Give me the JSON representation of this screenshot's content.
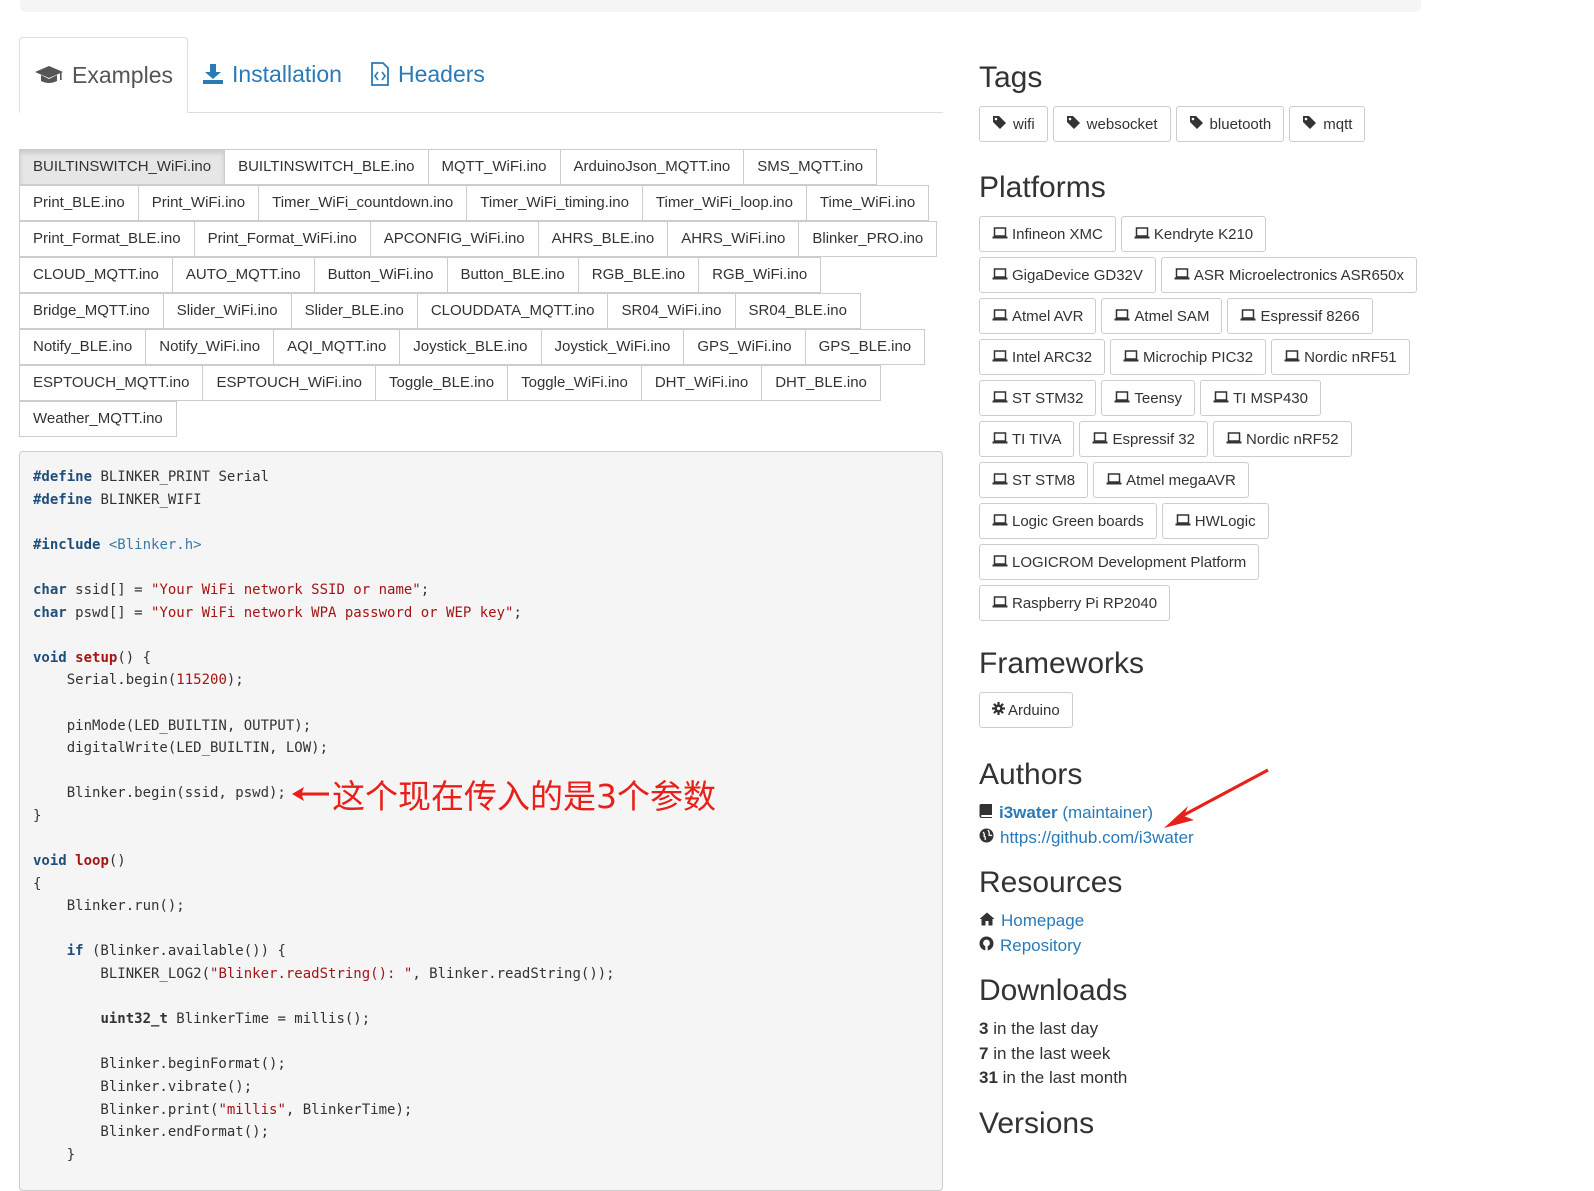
{
  "tabs": [
    {
      "label": "Examples",
      "icon": "graduation-cap-icon",
      "active": true
    },
    {
      "label": "Installation",
      "icon": "download-icon",
      "active": false
    },
    {
      "label": "Headers",
      "icon": "code-file-icon",
      "active": false
    }
  ],
  "file_rows": [
    [
      "BUILTINSWITCH_WiFi.ino",
      "BUILTINSWITCH_BLE.ino",
      "MQTT_WiFi.ino",
      "ArduinoJson_MQTT.ino",
      "SMS_MQTT.ino"
    ],
    [
      "Print_BLE.ino",
      "Print_WiFi.ino",
      "Timer_WiFi_countdown.ino",
      "Timer_WiFi_timing.ino",
      "Timer_WiFi_loop.ino",
      "Time_WiFi.ino"
    ],
    [
      "Print_Format_BLE.ino",
      "Print_Format_WiFi.ino",
      "APCONFIG_WiFi.ino",
      "AHRS_BLE.ino",
      "AHRS_WiFi.ino",
      "Blinker_PRO.ino"
    ],
    [
      "CLOUD_MQTT.ino",
      "AUTO_MQTT.ino",
      "Button_WiFi.ino",
      "Button_BLE.ino",
      "RGB_BLE.ino",
      "RGB_WiFi.ino"
    ],
    [
      "Bridge_MQTT.ino",
      "Slider_WiFi.ino",
      "Slider_BLE.ino",
      "CLOUDDATA_MQTT.ino",
      "SR04_WiFi.ino",
      "SR04_BLE.ino"
    ],
    [
      "Notify_BLE.ino",
      "Notify_WiFi.ino",
      "AQI_MQTT.ino",
      "Joystick_BLE.ino",
      "Joystick_WiFi.ino",
      "GPS_WiFi.ino",
      "GPS_BLE.ino"
    ],
    [
      "ESPTOUCH_MQTT.ino",
      "ESPTOUCH_WiFi.ino",
      "Toggle_BLE.ino",
      "Toggle_WiFi.ino",
      "DHT_WiFi.ino",
      "DHT_BLE.ino"
    ],
    [
      "Weather_MQTT.ino"
    ]
  ],
  "active_file": "BUILTINSWITCH_WiFi.ino",
  "code_lines": [
    [
      [
        "pp",
        "#define"
      ],
      [
        "t",
        " BLINKER_PRINT Serial"
      ]
    ],
    [
      [
        "pp",
        "#define"
      ],
      [
        "t",
        " BLINKER_WIFI"
      ]
    ],
    [],
    [
      [
        "pp",
        "#include"
      ],
      [
        "t",
        " "
      ],
      [
        "inc",
        "<Blinker.h>"
      ]
    ],
    [],
    [
      [
        "kw",
        "char"
      ],
      [
        "t",
        " ssid[] = "
      ],
      [
        "str",
        "\"Your WiFi network SSID or name\""
      ],
      [
        "t",
        ";"
      ]
    ],
    [
      [
        "kw",
        "char"
      ],
      [
        "t",
        " pswd[] = "
      ],
      [
        "str",
        "\"Your WiFi network WPA password or WEP key\""
      ],
      [
        "t",
        ";"
      ]
    ],
    [],
    [
      [
        "kw",
        "void"
      ],
      [
        "t",
        " "
      ],
      [
        "fn",
        "setup"
      ],
      [
        "t",
        "() {"
      ]
    ],
    [
      [
        "t",
        "    Serial.begin("
      ],
      [
        "num",
        "115200"
      ],
      [
        "t",
        ");"
      ]
    ],
    [],
    [
      [
        "t",
        "    pinMode(LED_BUILTIN, OUTPUT);"
      ]
    ],
    [
      [
        "t",
        "    digitalWrite(LED_BUILTIN, LOW);"
      ]
    ],
    [],
    [
      [
        "t",
        "    Blinker.begin(ssid, pswd);"
      ]
    ],
    [
      [
        "t",
        "}"
      ]
    ],
    [],
    [
      [
        "kw",
        "void"
      ],
      [
        "t",
        " "
      ],
      [
        "fn",
        "loop"
      ],
      [
        "t",
        "()"
      ]
    ],
    [
      [
        "t",
        "{"
      ]
    ],
    [
      [
        "t",
        "    Blinker.run();"
      ]
    ],
    [],
    [
      [
        "t",
        "    "
      ],
      [
        "kw",
        "if"
      ],
      [
        "t",
        " (Blinker.available()) {"
      ]
    ],
    [
      [
        "t",
        "        BLINKER_LOG2("
      ],
      [
        "str",
        "\"Blinker.readString(): \""
      ],
      [
        "t",
        ", Blinker.readString());"
      ]
    ],
    [],
    [
      [
        "t",
        "        "
      ],
      [
        "type",
        "uint32_t"
      ],
      [
        "t",
        " BlinkerTime = millis();"
      ]
    ],
    [],
    [
      [
        "t",
        "        Blinker.beginFormat();"
      ]
    ],
    [
      [
        "t",
        "        Blinker.vibrate();"
      ]
    ],
    [
      [
        "t",
        "        Blinker.print("
      ],
      [
        "str",
        "\"millis\""
      ],
      [
        "t",
        ", BlinkerTime);"
      ]
    ],
    [
      [
        "t",
        "        Blinker.endFormat();"
      ]
    ],
    [
      [
        "t",
        "    }"
      ]
    ]
  ],
  "annotation": "这个现在传入的是3个参数",
  "sidebar": {
    "tags_title": "Tags",
    "tags": [
      "wifi",
      "websocket",
      "bluetooth",
      "mqtt"
    ],
    "platforms_title": "Platforms",
    "platform_rows": [
      [
        "Infineon XMC",
        "Kendryte K210"
      ],
      [
        "GigaDevice GD32V",
        "ASR Microelectronics ASR650x"
      ],
      [
        "Atmel AVR",
        "Atmel SAM",
        "Espressif 8266"
      ],
      [
        "Intel ARC32",
        "Microchip PIC32",
        "Nordic nRF51"
      ],
      [
        "ST STM32",
        "Teensy",
        "TI MSP430"
      ],
      [
        "TI TIVA",
        "Espressif 32",
        "Nordic nRF52"
      ],
      [
        "ST STM8",
        "Atmel megaAVR"
      ],
      [
        "Logic Green boards",
        "HWLogic"
      ],
      [
        "LOGICROM Development Platform"
      ],
      [
        "Raspberry Pi RP2040"
      ]
    ],
    "frameworks_title": "Frameworks",
    "frameworks": [
      "Arduino"
    ],
    "authors_title": "Authors",
    "author_name": "i3water",
    "author_role": "(maintainer)",
    "author_url": "https://github.com/i3water",
    "resources_title": "Resources",
    "resources": [
      {
        "label": "Homepage",
        "icon": "home-icon"
      },
      {
        "label": "Repository",
        "icon": "github-icon"
      }
    ],
    "downloads_title": "Downloads",
    "downloads": [
      {
        "count": "3",
        "label": "in the last day"
      },
      {
        "count": "7",
        "label": "in the last week"
      },
      {
        "count": "31",
        "label": "in the last month"
      }
    ],
    "versions_title": "Versions"
  },
  "colors": {
    "link": "#2a7ab8",
    "annotation": "#e8201a"
  }
}
